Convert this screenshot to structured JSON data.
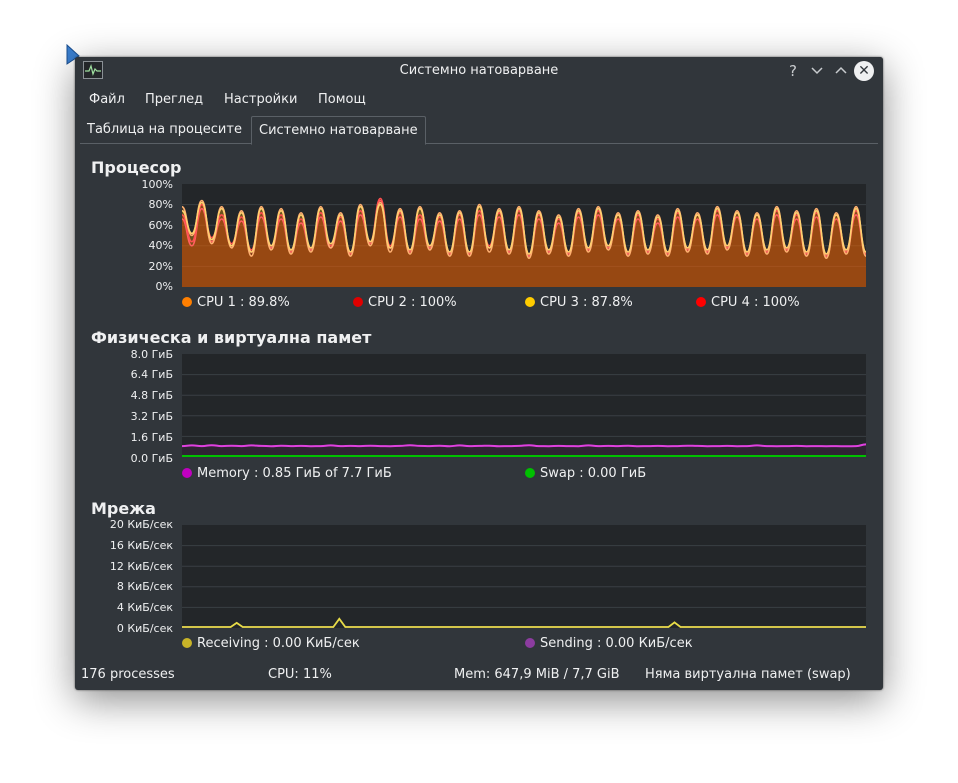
{
  "window": {
    "title": "Системно натоварване"
  },
  "menu": [
    "Файл",
    "Преглед",
    "Настройки",
    "Помощ"
  ],
  "tabs": [
    {
      "label": "Таблица на процесите",
      "active": false
    },
    {
      "label": "Системно натоварване",
      "active": true
    }
  ],
  "sections": {
    "cpu": {
      "title": "Процесор",
      "yticks": [
        "100%",
        "80%",
        "60%",
        "40%",
        "20%",
        "0%"
      ],
      "legend": [
        {
          "label": "CPU 1 : 89.8%",
          "color": "#ff7f00"
        },
        {
          "label": "CPU 2 : 100%",
          "color": "#e00000"
        },
        {
          "label": "CPU 3 : 87.8%",
          "color": "#ffcc00"
        },
        {
          "label": "CPU 4 : 100%",
          "color": "#ff0000"
        }
      ]
    },
    "memory": {
      "title": "Физическа и виртуална памет",
      "yticks": [
        "8.0 ГиБ",
        "6.4 ГиБ",
        "4.8 ГиБ",
        "3.2 ГиБ",
        "1.6 ГиБ",
        "0.0 ГиБ"
      ],
      "legend": [
        {
          "label": "Memory : 0.85 ГиБ of 7.7 ГиБ",
          "color": "#c000c0"
        },
        {
          "label": "Swap : 0.00 ГиБ",
          "color": "#00c000"
        }
      ]
    },
    "network": {
      "title": "Мрежа",
      "yticks": [
        "20 КиБ/сек",
        "16 КиБ/сек",
        "12 КиБ/сек",
        "8 КиБ/сек",
        "4 КиБ/сек",
        "0 КиБ/сек"
      ],
      "legend": [
        {
          "label": "Receiving : 0.00 КиБ/сек",
          "color": "#c8b428"
        },
        {
          "label": "Sending : 0.00 КиБ/сек",
          "color": "#8c3ca0"
        }
      ]
    }
  },
  "status": {
    "processes": "176 processes",
    "cpu": "CPU: 11%",
    "mem": "Mem: 647,9 MiB / 7,7 GiB",
    "swap": "Няма  виртуална памет (swap)"
  },
  "chart_data": [
    {
      "type": "area",
      "title": "Процесор",
      "ylim": [
        0,
        100
      ],
      "yticks": [
        "100%",
        "80%",
        "60%",
        "40%",
        "20%",
        "0%"
      ],
      "series": [
        {
          "name": "CPU 1",
          "color": "#ff7f00",
          "values": [
            78,
            50,
            84,
            42,
            78,
            38,
            74,
            30,
            78,
            36,
            76,
            32,
            72,
            34,
            78,
            38,
            72,
            30,
            80,
            40,
            82,
            34,
            76,
            32,
            78,
            36,
            72,
            30,
            74,
            30,
            80,
            34,
            76,
            32,
            78,
            28,
            74,
            32,
            70,
            30,
            76,
            34,
            78,
            36,
            72,
            30,
            74,
            32,
            70,
            30,
            76,
            34,
            72,
            32,
            78,
            36,
            74,
            30,
            72,
            32,
            78,
            34,
            74,
            30,
            76,
            28,
            72,
            32,
            78,
            30
          ]
        },
        {
          "name": "CPU 2",
          "color": "#e00000",
          "values": [
            70,
            44,
            80,
            48,
            70,
            42,
            68,
            36,
            72,
            40,
            70,
            36,
            66,
            38,
            72,
            40,
            68,
            34,
            74,
            44,
            86,
            40,
            72,
            36,
            70,
            40,
            68,
            34,
            70,
            34,
            74,
            40,
            72,
            36,
            74,
            32,
            70,
            36,
            66,
            34,
            72,
            38,
            74,
            40,
            70,
            34,
            70,
            36,
            66,
            34,
            72,
            38,
            70,
            36,
            74,
            40,
            72,
            34,
            70,
            36,
            74,
            38,
            70,
            34,
            72,
            32,
            70,
            36,
            74,
            34
          ]
        },
        {
          "name": "CPU 3",
          "color": "#ffcc00",
          "values": [
            74,
            52,
            82,
            46,
            76,
            40,
            72,
            34,
            76,
            40,
            74,
            36,
            70,
            38,
            76,
            42,
            70,
            34,
            78,
            44,
            80,
            38,
            74,
            36,
            76,
            40,
            70,
            34,
            72,
            34,
            78,
            38,
            74,
            36,
            76,
            32,
            72,
            36,
            68,
            34,
            74,
            38,
            76,
            40,
            70,
            34,
            72,
            36,
            68,
            34,
            74,
            38,
            70,
            36,
            76,
            40,
            72,
            34,
            70,
            36,
            76,
            38,
            72,
            34,
            74,
            32,
            70,
            36,
            76,
            34
          ]
        },
        {
          "name": "CPU 4",
          "color": "#ff0000",
          "values": [
            66,
            40,
            76,
            44,
            66,
            40,
            64,
            34,
            68,
            38,
            66,
            34,
            62,
            36,
            68,
            38,
            64,
            32,
            70,
            42,
            84,
            38,
            68,
            34,
            66,
            38,
            64,
            32,
            66,
            32,
            70,
            38,
            68,
            34,
            70,
            30,
            66,
            34,
            62,
            32,
            68,
            36,
            70,
            38,
            66,
            32,
            66,
            34,
            62,
            32,
            68,
            36,
            66,
            34,
            70,
            38,
            68,
            32,
            66,
            34,
            70,
            36,
            66,
            32,
            68,
            30,
            66,
            34,
            70,
            32
          ]
        }
      ]
    },
    {
      "type": "line",
      "title": "Физическа и виртуална памет",
      "ylim": [
        0,
        8.0
      ],
      "yticks": [
        "8.0 ГиБ",
        "6.4 ГиБ",
        "4.8 ГиБ",
        "3.2 ГиБ",
        "1.6 ГиБ",
        "0.0 ГиБ"
      ],
      "series": [
        {
          "name": "Memory",
          "color": "#c000c0",
          "values": [
            0.85,
            0.9,
            0.85,
            0.92,
            0.85,
            0.88,
            0.85,
            0.9,
            0.86,
            0.84,
            0.88,
            0.85,
            0.86,
            0.84,
            0.85,
            0.9,
            0.85,
            0.86,
            0.85,
            0.88,
            0.85,
            0.84,
            0.86,
            0.92,
            0.86,
            0.85,
            0.88,
            0.84,
            0.9,
            0.85,
            0.86,
            0.88,
            0.84,
            0.85,
            0.86,
            0.92,
            0.85,
            0.84,
            0.86,
            0.85,
            0.84,
            0.9,
            0.85,
            0.86,
            0.85,
            0.88,
            0.84,
            0.85,
            0.86,
            0.84,
            0.85,
            0.88,
            0.86,
            0.84,
            0.85,
            0.86,
            0.84,
            0.85,
            0.9,
            0.85,
            0.84,
            0.85,
            0.86,
            0.84,
            0.85,
            0.84,
            0.85,
            0.83,
            0.85,
            0.98
          ]
        },
        {
          "name": "Swap",
          "color": "#00c000",
          "values": [
            0,
            0
          ]
        }
      ]
    },
    {
      "type": "line",
      "title": "Мрежа",
      "ylim": [
        0,
        20
      ],
      "yticks": [
        "20 КиБ/сек",
        "16 КиБ/сек",
        "12 КиБ/сек",
        "8 КиБ/сек",
        "4 КиБ/сек",
        "0 КиБ/сек"
      ],
      "series": [
        {
          "name": "Receiving",
          "color": "#e6dc46",
          "values": [
            0,
            0,
            0,
            0,
            0,
            0,
            0,
            0,
            0,
            0,
            0,
            0,
            0,
            0,
            0,
            0,
            0,
            0,
            0,
            0,
            0,
            0,
            0,
            0,
            0,
            0,
            0,
            0,
            0,
            0,
            0,
            0,
            0,
            0,
            0,
            0,
            0,
            0,
            0,
            0,
            0,
            0,
            0,
            0,
            0,
            0,
            0,
            0,
            0,
            0,
            0,
            0,
            0,
            0,
            0,
            0,
            0,
            0,
            0,
            0,
            0,
            0,
            0,
            0,
            0,
            0,
            0,
            0,
            0,
            0
          ],
          "spikes": [
            [
              0.08,
              0.8
            ],
            [
              0.23,
              1.6
            ],
            [
              0.72,
              0.9
            ]
          ]
        },
        {
          "name": "Sending",
          "color": "#8c3ca0",
          "values": [
            0,
            0
          ]
        }
      ]
    }
  ]
}
